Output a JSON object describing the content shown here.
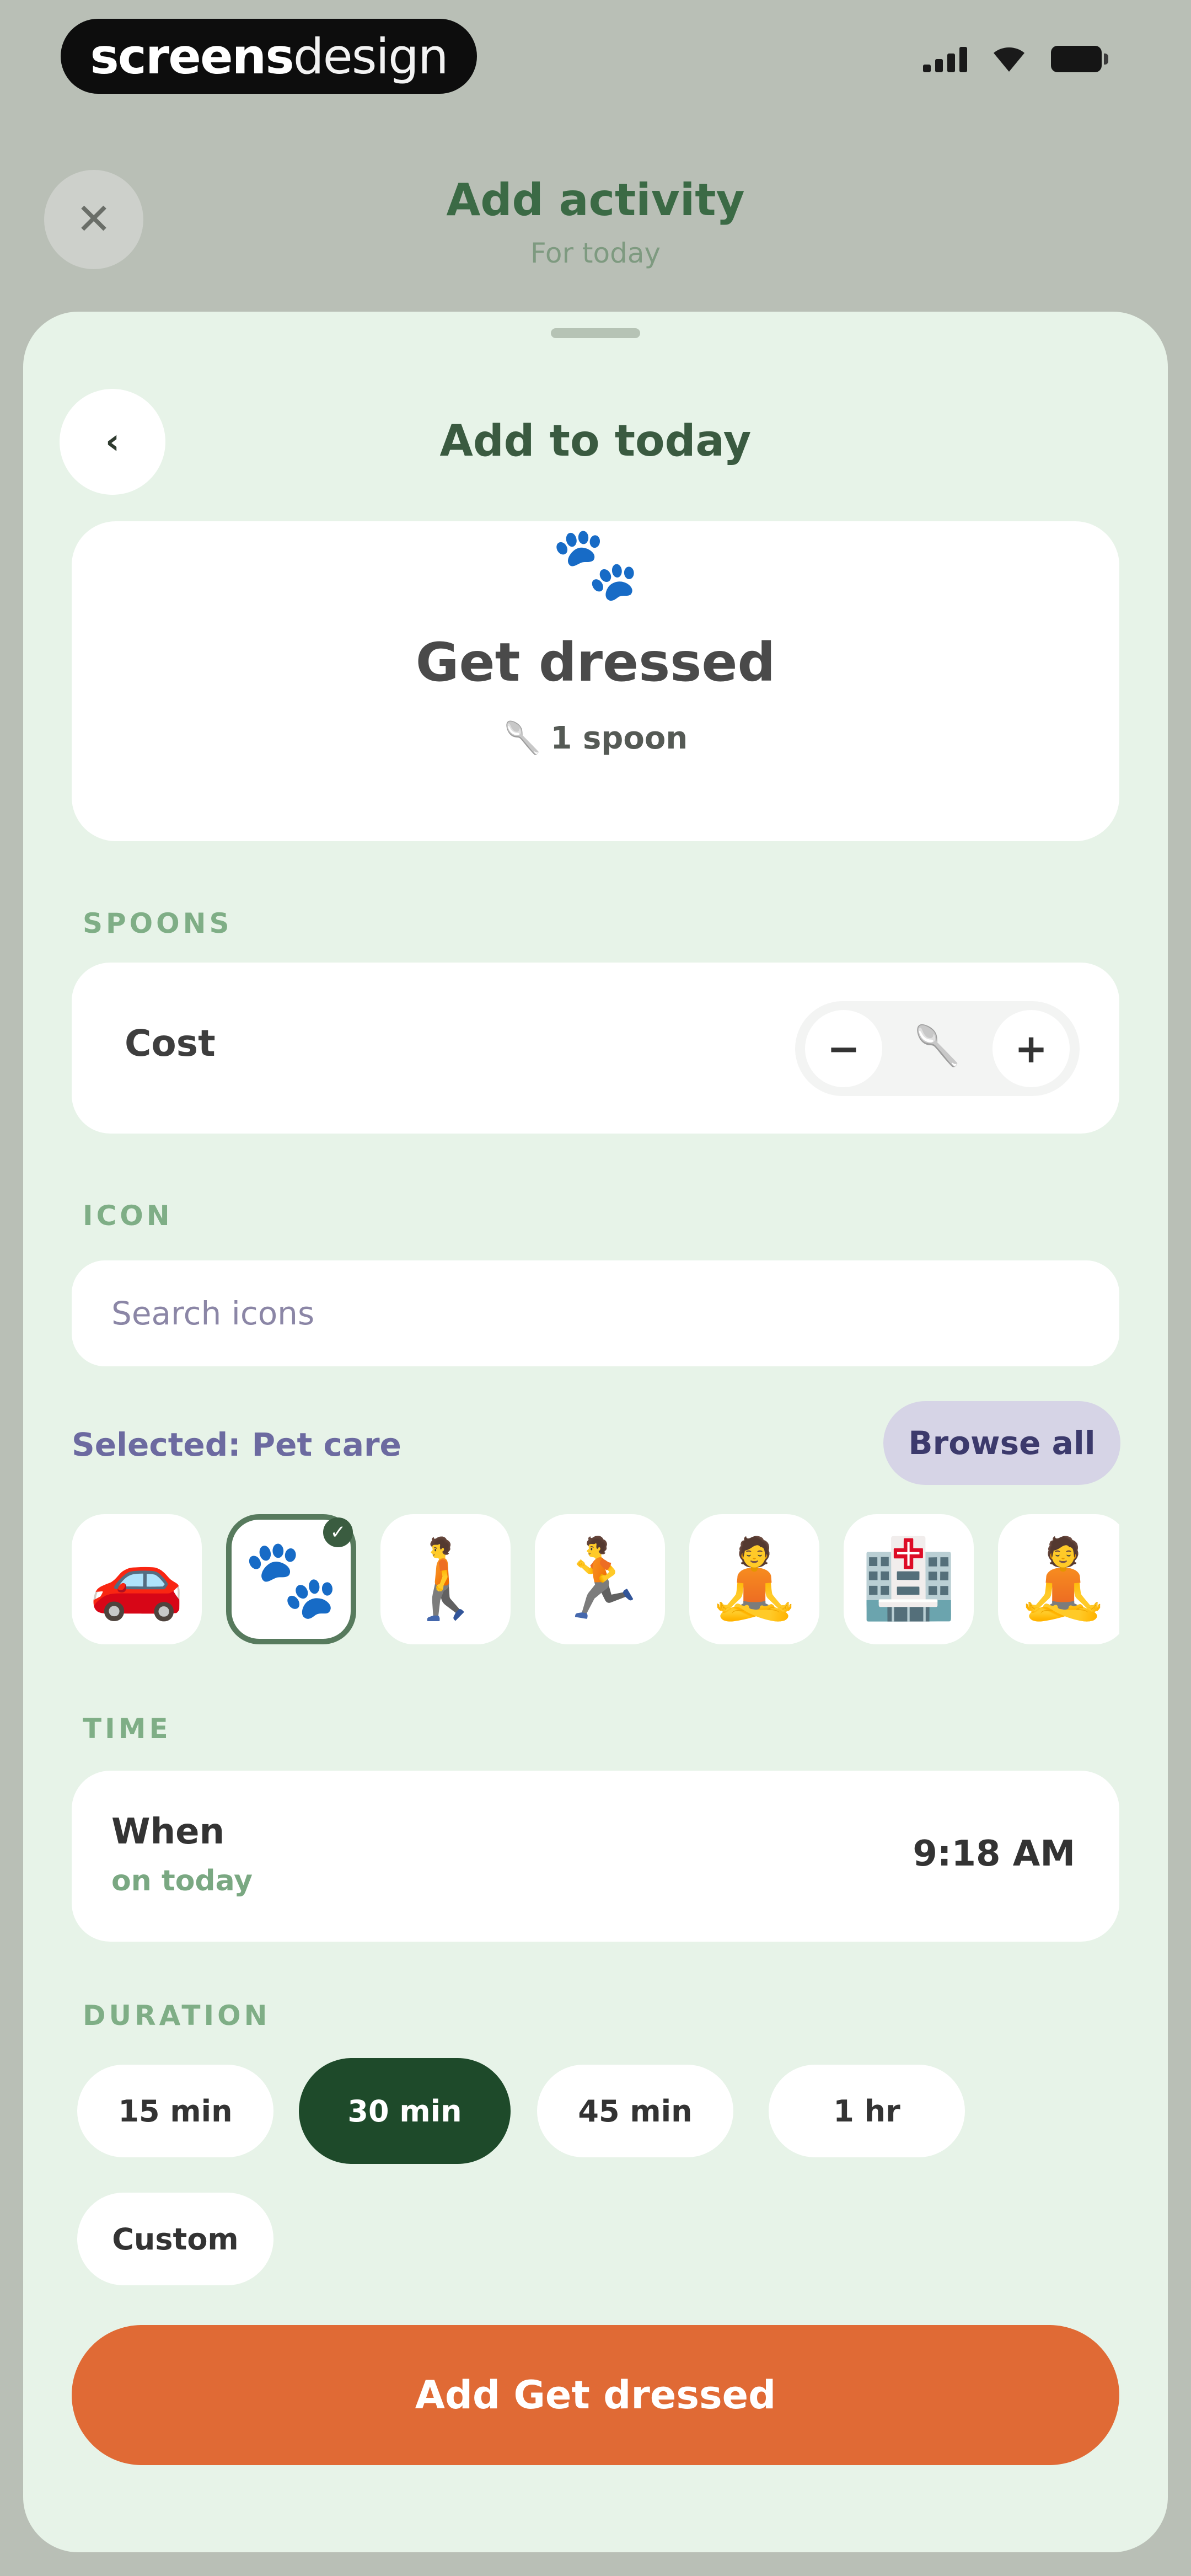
{
  "status_bar": {
    "brand_part1": "screens",
    "brand_part2": "design",
    "signal_icon": "cellular-signal-icon",
    "wifi_icon": "wifi-icon",
    "battery_icon": "battery-icon"
  },
  "background_header": {
    "close_icon": "✕",
    "title": "Add activity",
    "subtitle": "For today"
  },
  "sheet": {
    "back_icon": "‹",
    "title": "Add to today",
    "preview": {
      "icon": "paw-icon",
      "icon_glyph": "🐾",
      "name": "Get dressed",
      "cost_icon": "🥄",
      "cost_text": "1 spoon"
    },
    "spoons": {
      "section_label": "SPOONS",
      "cost_label": "Cost",
      "minus": "−",
      "plus": "+",
      "middle_icon": "🥄"
    },
    "icon_section": {
      "section_label": "ICON",
      "search_placeholder": "Search icons",
      "selected_text": "Selected: Pet care",
      "browse_label": "Browse all",
      "icons": [
        {
          "name": "car-icon",
          "glyph": "🚗"
        },
        {
          "name": "paw-icon",
          "glyph": "🐾",
          "selected": true
        },
        {
          "name": "walking-icon",
          "glyph": "🚶"
        },
        {
          "name": "running-icon",
          "glyph": "🏃"
        },
        {
          "name": "meditation-icon",
          "glyph": "🧘"
        },
        {
          "name": "hospital-icon",
          "glyph": "🏥"
        },
        {
          "name": "meditation-icon-2",
          "glyph": "🧘"
        }
      ],
      "check_glyph": "✓"
    },
    "time": {
      "section_label": "TIME",
      "when_label": "When",
      "when_sub": "on today",
      "time_value": "9:18 AM"
    },
    "duration": {
      "section_label": "DURATION",
      "chips": [
        "15 min",
        "30 min",
        "45 min",
        "1 hr",
        "Custom"
      ],
      "active_index": 1
    },
    "cta_label": "Add Get dressed"
  },
  "colors": {
    "accent_green": "#1e4a2a",
    "cta_orange": "#e06a35",
    "sheet_bg": "#e7f3e8"
  }
}
